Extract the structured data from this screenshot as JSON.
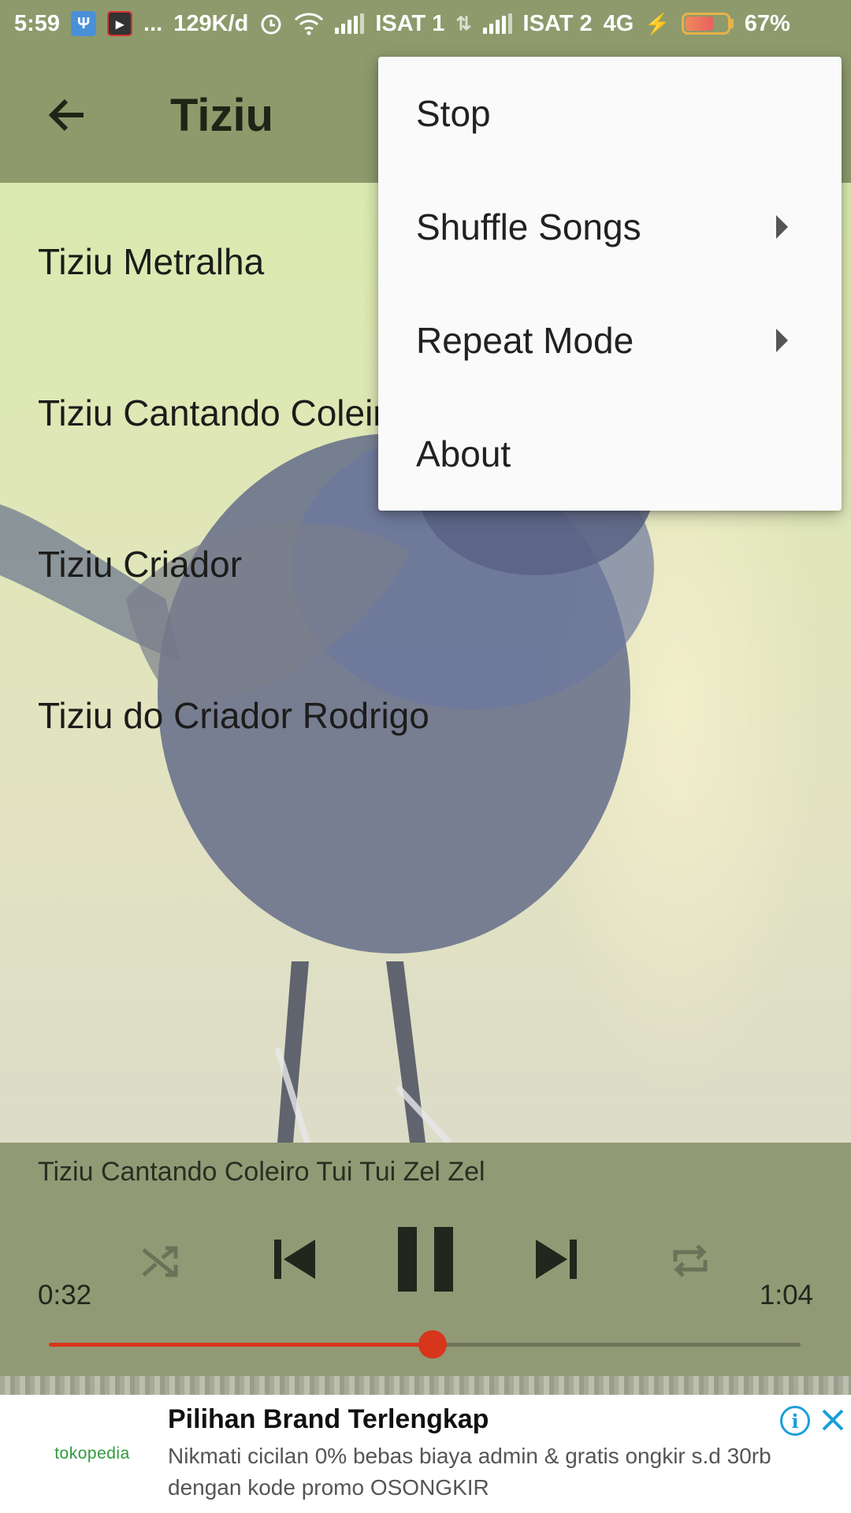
{
  "status_bar": {
    "time": "5:59",
    "more": "...",
    "speed": "129K/d",
    "sim1": "ISAT 1",
    "sim2": "ISAT 2",
    "network": "4G",
    "battery": "67%",
    "battery_level": 0.67
  },
  "app_bar": {
    "title": "Tiziu"
  },
  "songs": [
    {
      "title": "Tiziu Metralha"
    },
    {
      "title": "Tiziu Cantando Coleiro Tui Tui Zel Zel"
    },
    {
      "title": "Tiziu Criador"
    },
    {
      "title": "Tiziu do Criador Rodrigo"
    }
  ],
  "menu": {
    "items": [
      {
        "label": "Stop",
        "submenu": false
      },
      {
        "label": "Shuffle Songs",
        "submenu": true
      },
      {
        "label": "Repeat Mode",
        "submenu": true
      },
      {
        "label": "About",
        "submenu": false
      }
    ]
  },
  "player": {
    "now_playing": "Tiziu Cantando Coleiro Tui Tui Zel Zel",
    "elapsed": "0:32",
    "duration": "1:04",
    "progress": 0.51,
    "state": "playing"
  },
  "ad": {
    "brand": "tokopedia",
    "title": "Pilihan Brand Terlengkap",
    "text": "Nikmati cicilan 0% bebas biaya admin & gratis ongkir s.d 30rb dengan kode promo OSONGKIR",
    "info_symbol": "i"
  },
  "colors": {
    "toolbar": "#8e9a6c",
    "accent": "#d7351c",
    "ad_info": "#1a9fd8"
  }
}
